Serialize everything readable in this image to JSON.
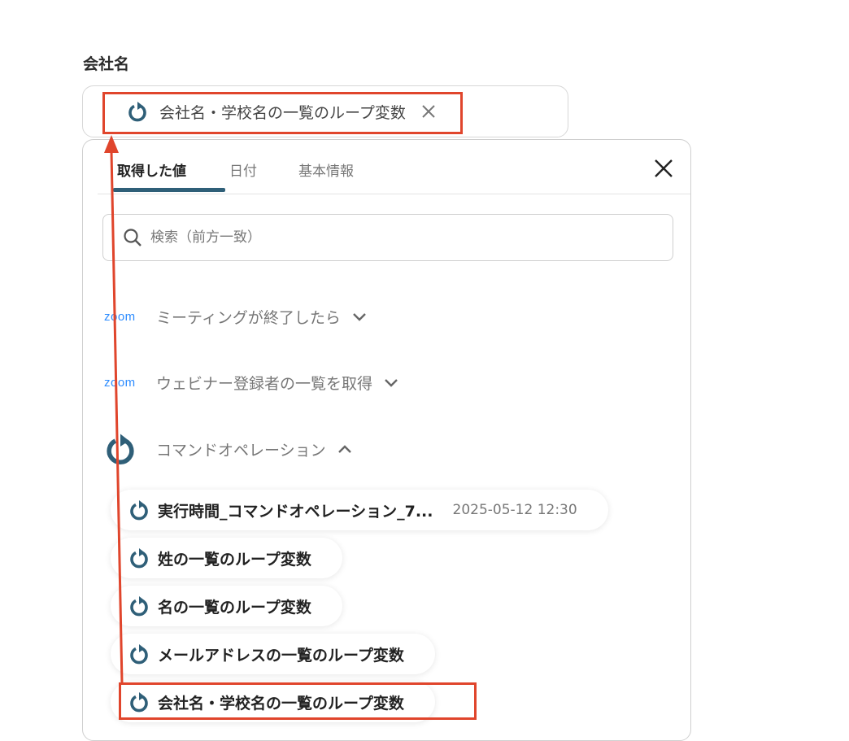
{
  "field": {
    "label": "会社名",
    "selected_chip": "会社名・学校名の一覧のループ変数",
    "remove_icon": "close-icon"
  },
  "panel": {
    "tabs": [
      {
        "label": "取得した値",
        "active": true
      },
      {
        "label": "日付",
        "active": false
      },
      {
        "label": "基本情報",
        "active": false
      }
    ],
    "close_icon": "close-icon",
    "search_placeholder": "検索（前方一致）",
    "groups": [
      {
        "logo": "zoom",
        "label": "ミーティングが終了したら",
        "expanded": false
      },
      {
        "logo": "zoom",
        "label": "ウェビナー登録者の一覧を取得",
        "expanded": false
      },
      {
        "logo": "loop-icon",
        "label": "コマンドオペレーション",
        "expanded": true
      }
    ],
    "items": [
      {
        "label": "実行時間_コマンドオペレーション_7...",
        "value": "2025-05-12 12:30"
      },
      {
        "label": "姓の一覧のループ変数",
        "value": ""
      },
      {
        "label": "名の一覧のループ変数",
        "value": ""
      },
      {
        "label": "メールアドレスの一覧のループ変数",
        "value": ""
      },
      {
        "label": "会社名・学校名の一覧のループ変数",
        "value": ""
      }
    ]
  },
  "colors": {
    "accent": "#2f5f78",
    "highlight": "#e0452c",
    "zoom": "#2d8cff"
  }
}
